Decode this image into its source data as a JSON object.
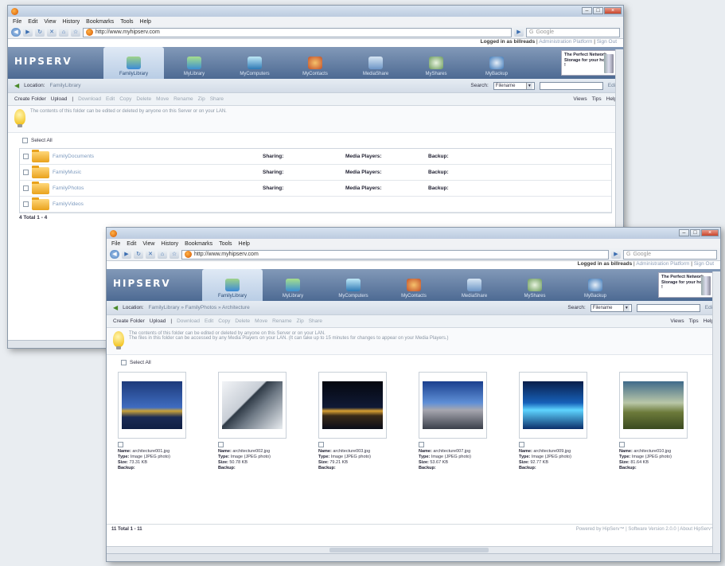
{
  "browser": {
    "menu": [
      "File",
      "Edit",
      "View",
      "History",
      "Bookmarks",
      "Tools",
      "Help"
    ],
    "url": "http://www.myhipserv.com",
    "search_placeholder": "Google"
  },
  "app": {
    "logo": "HIPSERV",
    "login_user_prefix": "Logged in as",
    "login_user": "billreads",
    "login_links": [
      "Administration Platform",
      "Sign Out"
    ],
    "tabs": [
      "FamilyLibrary",
      "MyLibrary",
      "MyComputers",
      "MyContacts",
      "MediaShare",
      "MyShares",
      "MyBackup"
    ],
    "ad": "The Perfect Network Storage for your home !"
  },
  "window1": {
    "location_label": "Location:",
    "location_path": "FamilyLibrary",
    "search_label": "Search:",
    "search_scope": "Filename",
    "search_button": "Edit",
    "toolbar_active": [
      "Create Folder",
      "Upload"
    ],
    "toolbar_disabled": [
      "Download",
      "Edit",
      "Copy",
      "Delete",
      "Move",
      "Rename",
      "Zip",
      "Share"
    ],
    "toolbar_right": [
      "Views",
      "Tips",
      "Help"
    ],
    "info_text": "The contents of this folder can be edited or deleted by anyone on this Server or on your LAN.",
    "select_all": "Select All",
    "col_sharing": "Sharing:",
    "col_media": "Media Players:",
    "col_backup": "Backup:",
    "folders": [
      "FamilyDocuments",
      "FamilyMusic",
      "FamilyPhotos",
      "FamilyVideos"
    ],
    "footer": "4 Total  1 - 4"
  },
  "window2": {
    "location_label": "Location:",
    "location_path": "FamilyLibrary » FamilyPhotos » Architecture",
    "search_label": "Search:",
    "search_scope": "Filename",
    "search_button": "Edit",
    "toolbar_active": [
      "Create Folder",
      "Upload"
    ],
    "toolbar_disabled": [
      "Download",
      "Edit",
      "Copy",
      "Delete",
      "Move",
      "Rename",
      "Zip",
      "Share"
    ],
    "toolbar_right": [
      "Views",
      "Tips",
      "Help"
    ],
    "info_line1": "The contents of this folder can be edited or deleted by anyone on this Server or on your LAN.",
    "info_line2": "The files in this folder can be accessed by any Media Players on your LAN. (It can take up to 15 minutes for changes to appear on your Media Players.)",
    "select_all": "Select All",
    "name_label": "Name:",
    "type_label": "Type:",
    "size_label": "Size:",
    "backup_label": "Backup:",
    "photos": [
      {
        "name": "architecture001.jpg",
        "type": "Image (JPEG photo)",
        "size": "73.31 KB"
      },
      {
        "name": "architecture002.jpg",
        "type": "Image (JPEG photo)",
        "size": "50.78 KB"
      },
      {
        "name": "architecture003.jpg",
        "type": "Image (JPEG photo)",
        "size": "79.21 KB"
      },
      {
        "name": "architecture007.jpg",
        "type": "Image (JPEG photo)",
        "size": "53.67 KB"
      },
      {
        "name": "architecture009.jpg",
        "type": "Image (JPEG photo)",
        "size": "92.77 KB"
      },
      {
        "name": "architecture010.jpg",
        "type": "Image (JPEG photo)",
        "size": "81.64 KB"
      }
    ],
    "footer_count": "11 Total  1 - 11",
    "powered": "Powered by HipServ™ | Software Version 2.0.0 | About HipServ™"
  }
}
